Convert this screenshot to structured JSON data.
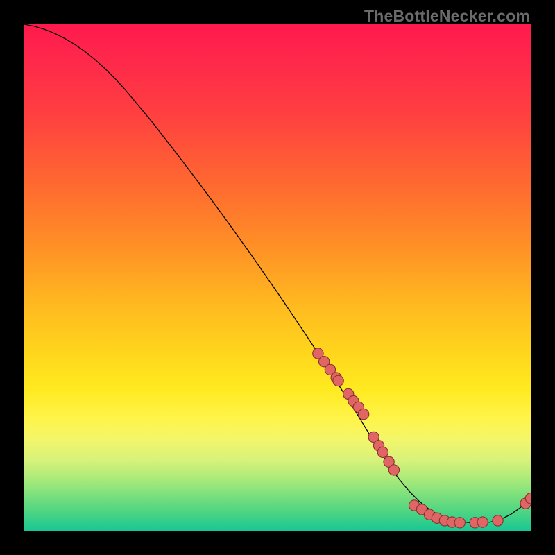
{
  "watermark": "TheBottleNecker.com",
  "chart_data": {
    "type": "line",
    "title": "",
    "xlabel": "",
    "ylabel": "",
    "xlim": [
      0,
      100
    ],
    "ylim": [
      0,
      100
    ],
    "grid": false,
    "legend": false,
    "series": [
      {
        "name": "curve",
        "x": [
          0,
          2,
          4,
          6,
          8,
          10,
          12,
          14,
          16,
          18,
          20,
          25,
          30,
          35,
          40,
          45,
          50,
          55,
          60,
          65,
          70,
          72,
          74,
          76,
          78,
          80,
          82,
          84,
          86,
          88,
          90,
          92,
          94,
          96,
          98,
          100
        ],
        "y": [
          100,
          99.6,
          99.0,
          98.2,
          97.2,
          96.0,
          94.6,
          93.0,
          91.2,
          89.2,
          87.0,
          81.0,
          74.6,
          68.0,
          61.2,
          54.2,
          47.0,
          39.6,
          32.0,
          24.2,
          16.0,
          13.0,
          10.2,
          7.8,
          5.8,
          4.2,
          3.0,
          2.2,
          1.8,
          1.6,
          1.6,
          1.7,
          2.2,
          3.2,
          4.6,
          6.4
        ]
      }
    ],
    "markers": [
      {
        "name": "cluster-upper",
        "points": [
          {
            "x": 58.0,
            "y": 35.0
          },
          {
            "x": 59.2,
            "y": 33.4
          },
          {
            "x": 60.4,
            "y": 31.8
          },
          {
            "x": 61.6,
            "y": 30.2
          },
          {
            "x": 62.0,
            "y": 29.6
          },
          {
            "x": 64.0,
            "y": 27.0
          },
          {
            "x": 65.0,
            "y": 25.6
          },
          {
            "x": 66.0,
            "y": 24.4
          },
          {
            "x": 67.0,
            "y": 23.0
          }
        ]
      },
      {
        "name": "cluster-mid",
        "points": [
          {
            "x": 69.0,
            "y": 18.5
          },
          {
            "x": 70.0,
            "y": 16.8
          },
          {
            "x": 70.8,
            "y": 15.5
          },
          {
            "x": 72.0,
            "y": 13.6
          },
          {
            "x": 73.0,
            "y": 12.0
          }
        ]
      },
      {
        "name": "cluster-bottom",
        "points": [
          {
            "x": 77.0,
            "y": 5.0
          },
          {
            "x": 78.5,
            "y": 4.2
          },
          {
            "x": 80.0,
            "y": 3.2
          },
          {
            "x": 81.5,
            "y": 2.5
          },
          {
            "x": 83.0,
            "y": 2.0
          },
          {
            "x": 84.5,
            "y": 1.7
          },
          {
            "x": 86.0,
            "y": 1.6
          },
          {
            "x": 89.0,
            "y": 1.6
          },
          {
            "x": 90.5,
            "y": 1.7
          },
          {
            "x": 93.5,
            "y": 2.0
          }
        ]
      },
      {
        "name": "tail-points",
        "points": [
          {
            "x": 99.0,
            "y": 5.4
          },
          {
            "x": 100.0,
            "y": 6.4
          }
        ]
      }
    ],
    "colors": {
      "curve": "#000000",
      "marker_fill": "#e06666",
      "marker_stroke": "#8a2f2f"
    }
  }
}
